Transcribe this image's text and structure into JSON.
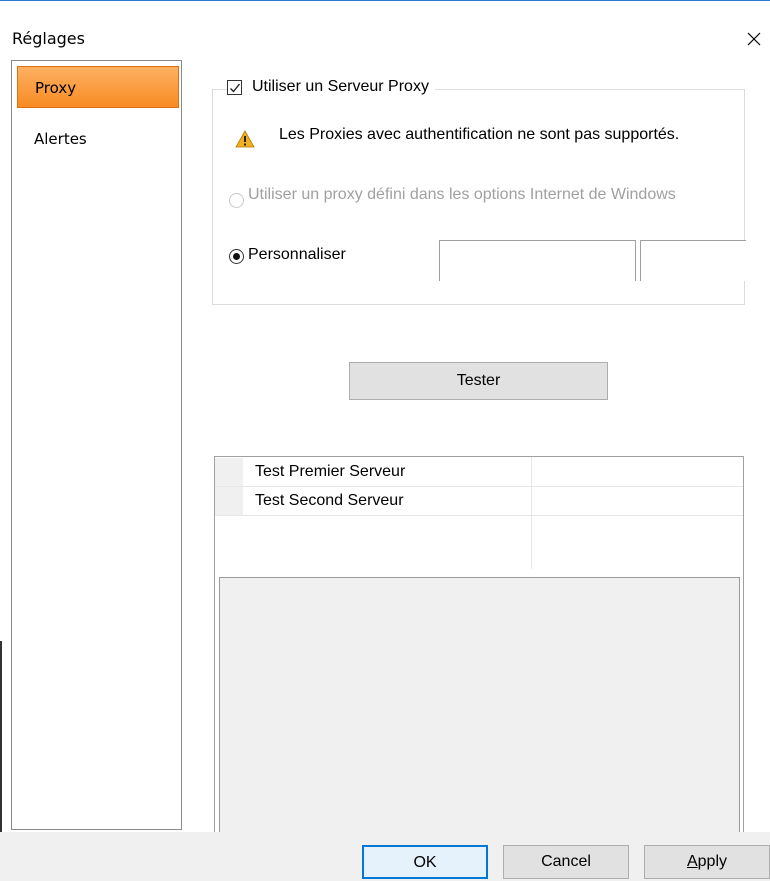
{
  "window": {
    "title": "Réglages"
  },
  "sidebar": {
    "items": [
      {
        "label": "Proxy",
        "active": true
      },
      {
        "label": "Alertes",
        "active": false
      }
    ]
  },
  "proxy": {
    "use_proxy_label": "Utiliser un Serveur Proxy",
    "use_proxy_checked": true,
    "warning_text": "Les Proxies avec authentification ne sont pas supportés.",
    "option_windows_label": "Utiliser un proxy défini dans les options Internet de Windows",
    "option_windows_enabled": false,
    "option_custom_label": "Personnaliser",
    "option_custom_selected": true,
    "host_value": "",
    "port_value": ""
  },
  "test": {
    "button_label": "Tester",
    "rows": [
      {
        "label": "Test Premier Serveur",
        "result": ""
      },
      {
        "label": "Test Second Serveur",
        "result": ""
      }
    ],
    "log_text": ""
  },
  "footer": {
    "ok_label": "OK",
    "cancel_label": "Cancel",
    "apply_label": "Apply",
    "apply_mnemonic": "A",
    "apply_rest": "pply"
  },
  "colors": {
    "accent_border": "#2b78d6",
    "sidebar_active": "#f88b23",
    "warning": "#f2b01e"
  }
}
